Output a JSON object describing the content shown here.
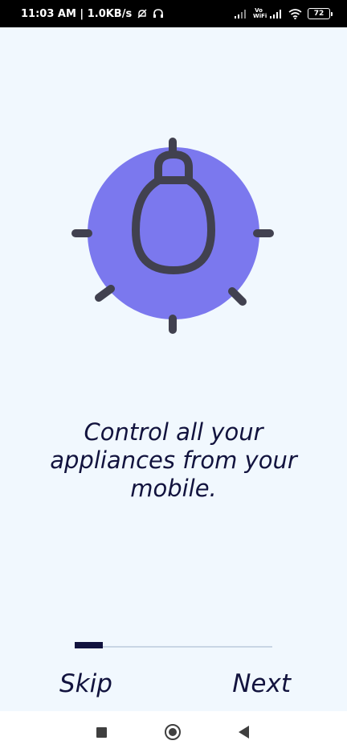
{
  "status_bar": {
    "time_speed": "11:03 AM | 1.0KB/s",
    "volte_label": "Vo WiFi",
    "battery": "72",
    "icons": [
      "mute-icon",
      "headphones-icon",
      "signal-icon",
      "wifi-icon",
      "battery-icon"
    ]
  },
  "onboarding": {
    "headline": "Control all your appliances from your mobile.",
    "illustration_icon": "lightbulb-icon",
    "progress": {
      "current_step": 1,
      "fraction": 0.14
    },
    "skip_label": "Skip",
    "next_label": "Next"
  },
  "colors": {
    "background": "#f1f8fe",
    "accent_circle": "#7b78ee",
    "text_dark": "#12133e",
    "icon_stroke": "#41414f"
  },
  "nav_bar": {
    "icons": [
      "recents-icon",
      "home-icon",
      "back-icon"
    ]
  }
}
